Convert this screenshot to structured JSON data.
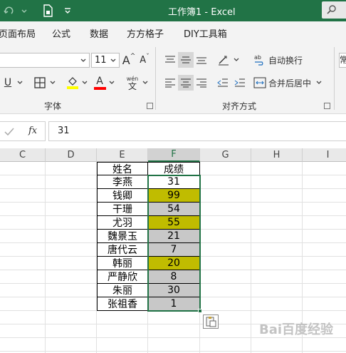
{
  "window": {
    "title": "工作簿1  -  Excel"
  },
  "menu": {
    "tabs": [
      "页面布局",
      "公式",
      "数据",
      "方方格子",
      "DIY工具箱"
    ]
  },
  "ribbon": {
    "font_size": "11",
    "font_group_label": "字体",
    "align_group_label": "对齐方式",
    "wrap_text_label": "自动换行",
    "merge_center_label": "合并后居中",
    "phonetic_glyph": "wén",
    "phonetic_char": "文",
    "number_format_partial": "常",
    "underline_glyph": "U",
    "font_color_glyph": "A",
    "grow_font_glyph": "A",
    "shrink_font_glyph": "A",
    "accent_colors": {
      "highlight": "#ffff00",
      "font_color": "#ff0000"
    }
  },
  "formula_bar": {
    "fx_label": "fx",
    "value": "31"
  },
  "columns": [
    "C",
    "D",
    "E",
    "F",
    "G",
    "H",
    "I"
  ],
  "selected_column": "F",
  "table": {
    "headers": [
      "姓名",
      "成绩"
    ],
    "rows": [
      {
        "name": "李燕",
        "score": "31",
        "fill": "none"
      },
      {
        "name": "钱卿",
        "score": "99",
        "fill": "#c0bc00"
      },
      {
        "name": "干珊",
        "score": "54",
        "fill": "#c8c8c8"
      },
      {
        "name": "尤羽",
        "score": "55",
        "fill": "#c0bc00"
      },
      {
        "name": "魏景玉",
        "score": "21",
        "fill": "#c8c8c8"
      },
      {
        "name": "唐代云",
        "score": "7",
        "fill": "#c8c8c8"
      },
      {
        "name": "韩丽",
        "score": "20",
        "fill": "#c0bc00"
      },
      {
        "name": "严静欣",
        "score": "8",
        "fill": "#c8c8c8"
      },
      {
        "name": "朱丽",
        "score": "30",
        "fill": "#c8c8c8"
      },
      {
        "name": "张祖香",
        "score": "1",
        "fill": "#c8c8c8"
      }
    ]
  },
  "watermark": "Bai百度经验"
}
